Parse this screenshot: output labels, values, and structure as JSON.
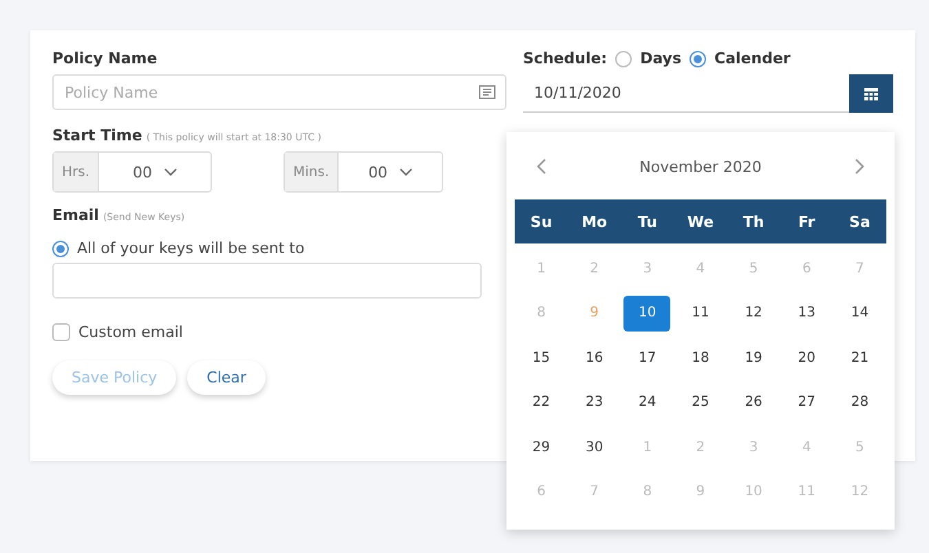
{
  "policy_name": {
    "label": "Policy Name",
    "placeholder": "Policy Name"
  },
  "start_time": {
    "label": "Start Time",
    "note": "( This policy will start at 18:30 UTC )",
    "hours": {
      "label": "Hrs.",
      "value": "00"
    },
    "minutes": {
      "label": "Mins.",
      "value": "00"
    }
  },
  "email": {
    "label": "Email",
    "note": "(Send New Keys)",
    "default_option": {
      "label": "All of your keys will be sent to",
      "selected": true
    },
    "custom_option": {
      "label": "Custom email",
      "checked": false
    }
  },
  "buttons": [
    {
      "label": "Save Policy",
      "disabled": true
    },
    {
      "label": "Clear",
      "disabled": false
    }
  ],
  "schedule": {
    "label": "Schedule:",
    "options": [
      {
        "label": "Days",
        "selected": false
      },
      {
        "label": "Calender",
        "selected": true
      }
    ],
    "date": "10/11/2020"
  },
  "calendar": {
    "month": "November  2020",
    "weekdays": [
      "Su",
      "Mo",
      "Tu",
      "We",
      "Th",
      "Fr",
      "Sa"
    ],
    "days": [
      {
        "day": "1",
        "muted": true,
        "today": false,
        "selected": false
      },
      {
        "day": "2",
        "muted": true,
        "today": false,
        "selected": false
      },
      {
        "day": "3",
        "muted": true,
        "today": false,
        "selected": false
      },
      {
        "day": "4",
        "muted": true,
        "today": false,
        "selected": false
      },
      {
        "day": "5",
        "muted": true,
        "today": false,
        "selected": false
      },
      {
        "day": "6",
        "muted": true,
        "today": false,
        "selected": false
      },
      {
        "day": "7",
        "muted": true,
        "today": false,
        "selected": false
      },
      {
        "day": "8",
        "muted": true,
        "today": false,
        "selected": false
      },
      {
        "day": "9",
        "muted": true,
        "today": true,
        "selected": false
      },
      {
        "day": "10",
        "muted": false,
        "today": false,
        "selected": true
      },
      {
        "day": "11",
        "muted": false,
        "today": false,
        "selected": false
      },
      {
        "day": "12",
        "muted": false,
        "today": false,
        "selected": false
      },
      {
        "day": "13",
        "muted": false,
        "today": false,
        "selected": false
      },
      {
        "day": "14",
        "muted": false,
        "today": false,
        "selected": false
      },
      {
        "day": "15",
        "muted": false,
        "today": false,
        "selected": false
      },
      {
        "day": "16",
        "muted": false,
        "today": false,
        "selected": false
      },
      {
        "day": "17",
        "muted": false,
        "today": false,
        "selected": false
      },
      {
        "day": "18",
        "muted": false,
        "today": false,
        "selected": false
      },
      {
        "day": "19",
        "muted": false,
        "today": false,
        "selected": false
      },
      {
        "day": "20",
        "muted": false,
        "today": false,
        "selected": false
      },
      {
        "day": "21",
        "muted": false,
        "today": false,
        "selected": false
      },
      {
        "day": "22",
        "muted": false,
        "today": false,
        "selected": false
      },
      {
        "day": "23",
        "muted": false,
        "today": false,
        "selected": false
      },
      {
        "day": "24",
        "muted": false,
        "today": false,
        "selected": false
      },
      {
        "day": "25",
        "muted": false,
        "today": false,
        "selected": false
      },
      {
        "day": "26",
        "muted": false,
        "today": false,
        "selected": false
      },
      {
        "day": "27",
        "muted": false,
        "today": false,
        "selected": false
      },
      {
        "day": "28",
        "muted": false,
        "today": false,
        "selected": false
      },
      {
        "day": "29",
        "muted": false,
        "today": false,
        "selected": false
      },
      {
        "day": "30",
        "muted": false,
        "today": false,
        "selected": false
      },
      {
        "day": "1",
        "muted": true,
        "today": false,
        "selected": false
      },
      {
        "day": "2",
        "muted": true,
        "today": false,
        "selected": false
      },
      {
        "day": "3",
        "muted": true,
        "today": false,
        "selected": false
      },
      {
        "day": "4",
        "muted": true,
        "today": false,
        "selected": false
      },
      {
        "day": "5",
        "muted": true,
        "today": false,
        "selected": false
      },
      {
        "day": "6",
        "muted": true,
        "today": false,
        "selected": false
      },
      {
        "day": "7",
        "muted": true,
        "today": false,
        "selected": false
      },
      {
        "day": "8",
        "muted": true,
        "today": false,
        "selected": false
      },
      {
        "day": "9",
        "muted": true,
        "today": false,
        "selected": false
      },
      {
        "day": "10",
        "muted": true,
        "today": false,
        "selected": false
      },
      {
        "day": "11",
        "muted": true,
        "today": false,
        "selected": false
      },
      {
        "day": "12",
        "muted": true,
        "today": false,
        "selected": false
      }
    ]
  }
}
